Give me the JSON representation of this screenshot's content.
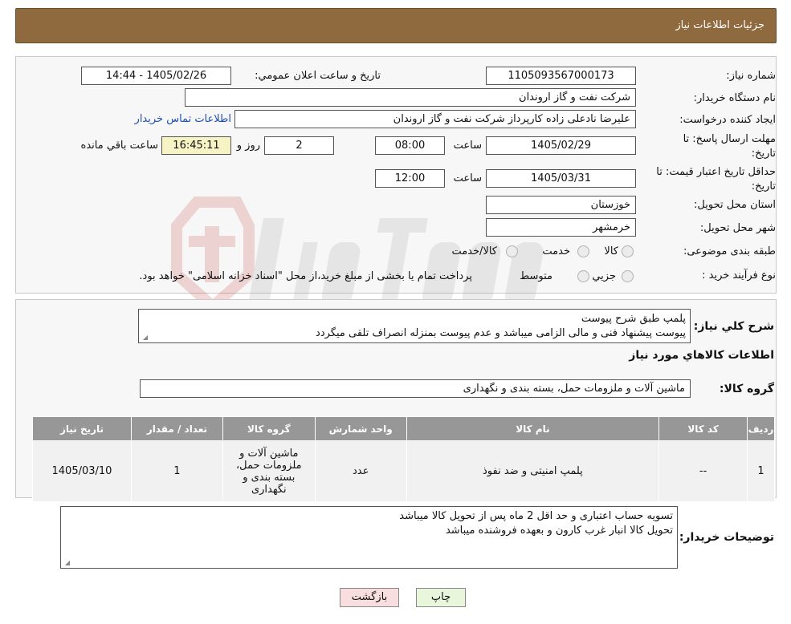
{
  "header": {
    "title": "جزئیات اطلاعات نیاز"
  },
  "form": {
    "need_number_label": "شماره نیاز:",
    "need_number": "1105093567000173",
    "announce_label": "تاریخ و ساعت اعلان عمومي:",
    "announce_value": "1405/02/26 - 14:44",
    "buyer_org_label": "نام دستگاه خريدار:",
    "buyer_org": "شرکت نفت و گاز اروندان",
    "creator_label": "ايجاد کننده درخواست:",
    "creator": "عليرضا نادعلی زاده کارپرداز شرکت نفت و گاز اروندان",
    "contact_link": "اطلاعات تماس خريدار",
    "deadline_label_1": "مهلت ارسال پاسخ: تا",
    "deadline_label_2": "تاريخ:",
    "deadline_date": "1405/02/29",
    "time_label": "ساعت",
    "deadline_time": "08:00",
    "days_value": "2",
    "days_label": "روز و",
    "remaining_time": "16:45:11",
    "remaining_label": "ساعت باقي مانده",
    "validity_label_1": "حداقل تاريخ اعتبار قيمت: تا",
    "validity_label_2": "تاريخ:",
    "validity_date": "1405/03/31",
    "validity_time_label": "ساعت",
    "validity_time": "12:00",
    "province_label": "استان محل تحويل:",
    "province": "خوزستان",
    "city_label": "شهر محل تحويل:",
    "city": "خرمشهر",
    "category_label": "طبقه بندی موضوعی:",
    "category_options": [
      "کالا",
      "خدمت",
      "کالا/خدمت"
    ],
    "process_label": "نوع فرآيند خريد :",
    "process_options": [
      "جزيي",
      "متوسط"
    ],
    "process_note": "پرداخت تمام يا بخشی از مبلغ خريد،از محل \"اسناد خزانه اسلامی\" خواهد بود."
  },
  "general": {
    "desc_label": "شرح كلي نياز:",
    "desc_line1": "پلمپ طبق شرح پیوست",
    "desc_line2": "پیوست پیشنهاد فنی و مالی الزامی میباشد و عدم پیوست بمنزله انصراف تلقی میگردد",
    "items_title": "اطلاعات كالاهاي مورد نياز",
    "group_label": "گروه كالا:",
    "group_value": "ماشین آلات و ملزومات حمل، بسته بندی و نگهداری"
  },
  "table": {
    "headers": [
      "رديف",
      "كد كالا",
      "نام كالا",
      "واحد شمارش",
      "گروه كالا",
      "تعداد / مقدار",
      "تاريخ نياز"
    ],
    "row": [
      "1",
      "--",
      "پلمپ امنیتی و ضد نفوذ",
      "عدد",
      "ماشین آلات و ملزومات حمل، بسته بندی و نگهداری",
      "1",
      "1405/03/10"
    ]
  },
  "notes": {
    "label": "توضيحات خريدار:",
    "line1": "تسویه حساب اعتباری و حد اقل 2 ماه پس از تحویل کالا میباشد",
    "line2": "تحویل کالا انبار غرب کارون و بعهده فروشنده میباشد"
  },
  "buttons": {
    "print": "چاپ",
    "back": "بازگشت"
  },
  "colors": {
    "header_bg": "#8f6a3f",
    "print_bg": "#e8f7dc",
    "back_bg": "#f8dede",
    "link": "#1d4fb5"
  }
}
